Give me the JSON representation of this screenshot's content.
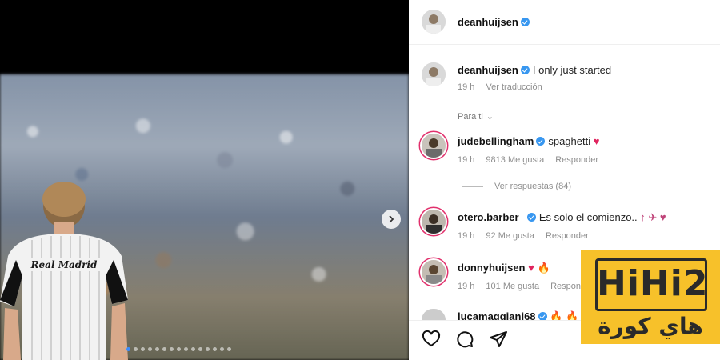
{
  "post": {
    "author": "deanhuijsen",
    "caption_user": "deanhuijsen",
    "caption": "I only just started",
    "caption_time": "19 h",
    "translate": "Ver traducción",
    "sort_label": "Para ti",
    "image": {
      "jersey_text": "Real Madrid",
      "dots_total": 15,
      "active_dot": 0
    }
  },
  "comments": [
    {
      "user": "judebellingham",
      "verified": true,
      "text": "spaghetti",
      "emojis": "♥",
      "time": "19 h",
      "likes": "9813 Me gusta",
      "reply": "Responder"
    },
    {
      "user": "otero.barber_",
      "verified": true,
      "text": "Es solo el comienzo..",
      "emojis": "↑ ✈ ♥",
      "time": "19 h",
      "likes": "92 Me gusta",
      "reply": "Responder"
    },
    {
      "user": "donnyhuijsen",
      "verified": false,
      "text": "",
      "emojis": "♥ 🔥",
      "time": "19 h",
      "likes": "101 Me gusta",
      "reply": "Respond"
    },
    {
      "user": "lucamaggiani68",
      "verified": true,
      "text": "",
      "emojis": "🔥 🔥",
      "time": "",
      "likes": "",
      "reply": ""
    }
  ],
  "replies_link": "Ver respuestas (84)",
  "actions": [
    "heart-icon",
    "comment-icon",
    "share-icon"
  ],
  "watermark": {
    "latin": "HiHi2",
    "arabic": "هاي كورة"
  },
  "colors": {
    "verified": "#3897f0",
    "heart": "#e0245e",
    "logo_bg": "#f7c12a"
  }
}
